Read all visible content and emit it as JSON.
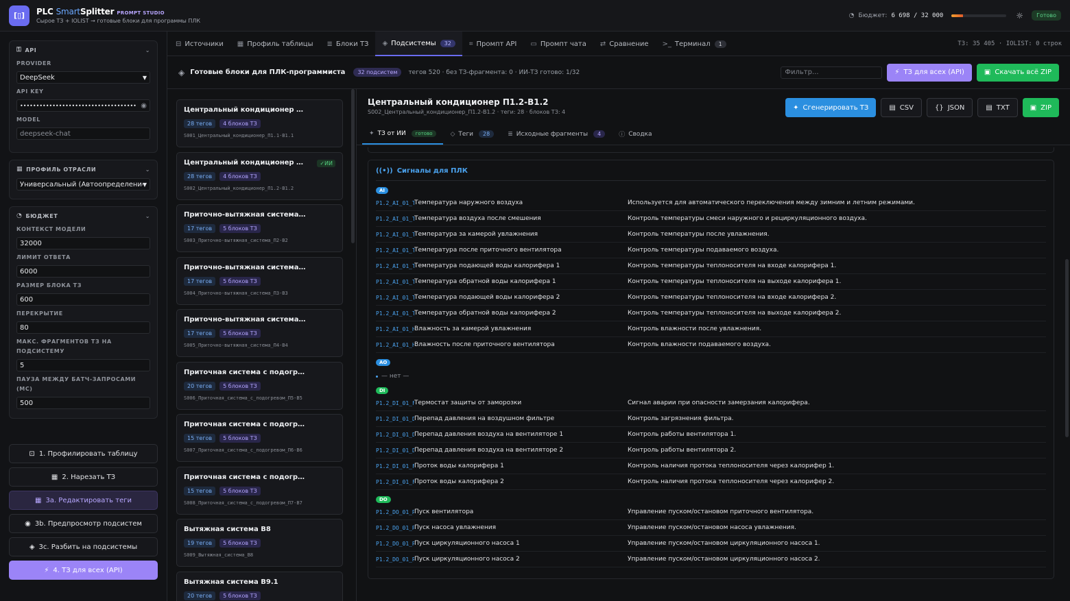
{
  "header": {
    "logo_glyph": "[▯]",
    "brand_plc": "PLC",
    "brand_smart": "Smart",
    "brand_splitter": "Splitter",
    "brand_suffix": "PROMPT STUDIO",
    "subtitle": "Сырое ТЗ + IOLIST → готовые блоки для программы ПЛК",
    "budget_label": "Бюджет:",
    "budget_value": "6 698 / 32 000",
    "budget_used": 6698,
    "budget_total": 32000,
    "status": "Готово"
  },
  "sidebar": {
    "api": {
      "title": "API",
      "provider_label": "PROVIDER",
      "provider_value": "DeepSeek",
      "apikey_label": "API KEY",
      "apikey_value": "••••••••••••••••••••••••••••••••••••",
      "model_label": "MODEL",
      "model_placeholder": "deepseek-chat"
    },
    "profile": {
      "title": "ПРОФИЛЬ ОТРАСЛИ",
      "value": "Универсальный (Автоопределение)"
    },
    "budget": {
      "title": "БЮДЖЕТ",
      "fields": [
        {
          "label": "КОНТЕКСТ МОДЕЛИ",
          "value": "32000"
        },
        {
          "label": "ЛИМИТ ОТВЕТА",
          "value": "6000"
        },
        {
          "label": "РАЗМЕР БЛОКА ТЗ",
          "value": "600"
        },
        {
          "label": "ПЕРЕКРЫТИЕ",
          "value": "80"
        },
        {
          "label": "МАКС. ФРАГМЕНТОВ ТЗ НА ПОДСИСТЕМУ",
          "value": "5"
        },
        {
          "label": "ПАУЗА МЕЖДУ БАТЧ-ЗАПРОСАМИ (МС)",
          "value": "500"
        }
      ]
    },
    "actions": [
      {
        "label": "1. Профилировать таблицу",
        "icon": "scan-icon"
      },
      {
        "label": "2. Нарезать ТЗ",
        "icon": "table-icon"
      },
      {
        "label": "3a. Редактировать теги",
        "icon": "table-icon"
      },
      {
        "label": "3b. Предпросмотр подсистем",
        "icon": "eye-icon"
      },
      {
        "label": "3c. Разбить на подсистемы",
        "icon": "layers-icon"
      },
      {
        "label": "4. ТЗ для всех (API)",
        "icon": "bolt-icon"
      }
    ]
  },
  "tabs": [
    {
      "label": "Источники",
      "icon": "folder-icon",
      "badge": ""
    },
    {
      "label": "Профиль таблицы",
      "icon": "table-icon",
      "badge": ""
    },
    {
      "label": "Блоки ТЗ",
      "icon": "doc-icon",
      "badge": ""
    },
    {
      "label": "Подсистемы",
      "icon": "layers-icon",
      "badge": "32"
    },
    {
      "label": "Промпт API",
      "icon": "code-icon",
      "badge": ""
    },
    {
      "label": "Промпт чата",
      "icon": "chat-icon",
      "badge": ""
    },
    {
      "label": "Сравнение",
      "icon": "compare-icon",
      "badge": ""
    },
    {
      "label": "Терминал",
      "icon": "terminal-icon",
      "badge": "1"
    }
  ],
  "tab_info": "ТЗ: 35 405 · IOLIST: 0 строк",
  "subheader": {
    "title": "Готовые блоки для ПЛК-программиста",
    "count_badge": "32 подсистем",
    "stats": "тегов 520 · без ТЗ-фрагмента: 0 · ИИ-ТЗ готово: 1/32",
    "filter_placeholder": "Фильтр...",
    "btn_all": "ТЗ для всех (API)",
    "btn_zip": "Скачать всё ZIP"
  },
  "subsystems": [
    {
      "title": "Центральный кондиционер П1.1-В1.1",
      "tags": "28 тегов",
      "blocks": "4 блоков ТЗ",
      "id": "S001_Центральный_кондиционер_П1.1-В1.1",
      "ai": ""
    },
    {
      "title": "Центральный кондиционер П1.2-В1.2",
      "tags": "28 тегов",
      "blocks": "4 блоков ТЗ",
      "id": "S002_Центральный_кондиционер_П1.2-В1.2",
      "ai": "✓ИИ"
    },
    {
      "title": "Приточно-вытяжная система П2-В2",
      "tags": "17 тегов",
      "blocks": "5 блоков ТЗ",
      "id": "S003_Приточно-вытяжная_система_П2-В2",
      "ai": ""
    },
    {
      "title": "Приточно-вытяжная система П3-В3",
      "tags": "17 тегов",
      "blocks": "5 блоков ТЗ",
      "id": "S004_Приточно-вытяжная_система_П3-В3",
      "ai": ""
    },
    {
      "title": "Приточно-вытяжная система П4-В4",
      "tags": "17 тегов",
      "blocks": "5 блоков ТЗ",
      "id": "S005_Приточно-вытяжная_система_П4-В4",
      "ai": ""
    },
    {
      "title": "Приточная система с подогревом П5-В5",
      "tags": "20 тегов",
      "blocks": "5 блоков ТЗ",
      "id": "S006_Приточная_система_с_подогревом_П5-В5",
      "ai": ""
    },
    {
      "title": "Приточная система с подогревом П6-В6",
      "tags": "15 тегов",
      "blocks": "5 блоков ТЗ",
      "id": "S007_Приточная_система_с_подогревом_П6-В6",
      "ai": ""
    },
    {
      "title": "Приточная система с подогревом П7-В7",
      "tags": "15 тегов",
      "blocks": "5 блоков ТЗ",
      "id": "S008_Приточная_система_с_подогревом_П7-В7",
      "ai": ""
    },
    {
      "title": "Вытяжная система В8",
      "tags": "19 тегов",
      "blocks": "5 блоков ТЗ",
      "id": "S009_Вытяжная_система_В8",
      "ai": ""
    },
    {
      "title": "Вытяжная система В9.1",
      "tags": "20 тегов",
      "blocks": "5 блоков ТЗ",
      "id": "S010_Вытяжная_система_В9.1",
      "ai": ""
    }
  ],
  "detail": {
    "title": "Центральный кондиционер П1.2-В1.2",
    "subtitle": "S002_Центральный_кондиционер_П1.2-В1.2 · теги: 28 · блоков ТЗ: 4",
    "btn_generate": "Сгенерировать ТЗ",
    "btn_csv": "CSV",
    "btn_json": "JSON",
    "btn_txt": "TXT",
    "btn_zip": "ZIP",
    "tabs": [
      {
        "label": "ТЗ от ИИ",
        "badge": "готово",
        "icon": "sparkle-icon"
      },
      {
        "label": "Теги",
        "badge": "28",
        "icon": "tag-icon"
      },
      {
        "label": "Исходные фрагменты",
        "badge": "4",
        "icon": "doc-icon"
      },
      {
        "label": "Сводка",
        "badge": "",
        "icon": "info-icon"
      }
    ],
    "signals_title": "Сигналы для ПЛК",
    "groups": [
      {
        "name": "AI",
        "rows": [
          {
            "id": "P1.2_AI_01_Temp",
            "name": "Температура наружного воздуха",
            "desc": "Используется для автоматического переключения между зимним и летним режимами."
          },
          {
            "id": "P1.2_AI_01_Temp",
            "name": "Температура воздуха после смешения",
            "desc": "Контроль температуры смеси наружного и рециркуляционного воздуха."
          },
          {
            "id": "P1.2_AI_01_Temp",
            "name": "Температура за камерой увлажнения",
            "desc": "Контроль температуры после увлажнения."
          },
          {
            "id": "P1.2_AI_01_Temp",
            "name": "Температура после приточного вентилятора",
            "desc": "Контроль температуры подаваемого воздуха."
          },
          {
            "id": "P1.2_AI_01_Temp",
            "name": "Температура подающей воды калорифера 1",
            "desc": "Контроль температуры теплоносителя на входе калорифера 1."
          },
          {
            "id": "P1.2_AI_01_Temp",
            "name": "Температура обратной воды калорифера 1",
            "desc": "Контроль температуры теплоносителя на выходе калорифера 1."
          },
          {
            "id": "P1.2_AI_01_Temp",
            "name": "Температура подающей воды калорифера 2",
            "desc": "Контроль температуры теплоносителя на входе калорифера 2."
          },
          {
            "id": "P1.2_AI_01_Temp",
            "name": "Температура обратной воды калорифера 2",
            "desc": "Контроль температуры теплоносителя на выходе калорифера 2."
          },
          {
            "id": "P1.2_AI_01_Hum",
            "name": "Влажность за камерой увлажнения",
            "desc": "Контроль влажности после увлажнения."
          },
          {
            "id": "P1.2_AI_01_Hum",
            "name": "Влажность после приточного вентилятора",
            "desc": "Контроль влажности подаваемого воздуха."
          }
        ]
      },
      {
        "name": "AO",
        "rows": [],
        "none": "— нет —"
      },
      {
        "name": "DI",
        "rows": [
          {
            "id": "P1.2_DI_01_Frz",
            "name": "Термостат защиты от заморозки",
            "desc": "Сигнал аварии при опасности замерзания калорифера."
          },
          {
            "id": "P1.2_DI_01_DPF",
            "name": "Перепад давления на воздушном фильтре",
            "desc": "Контроль загрязнения фильтра."
          },
          {
            "id": "P1.2_DI_01_DPV",
            "name": "Перепад давления воздуха на вентиляторе 1",
            "desc": "Контроль работы вентилятора 1."
          },
          {
            "id": "P1.2_DI_01_DPV",
            "name": "Перепад давления воздуха на вентиляторе 2",
            "desc": "Контроль работы вентилятора 2."
          },
          {
            "id": "P1.2_DI_01_Flw",
            "name": "Проток воды калорифера 1",
            "desc": "Контроль наличия протока теплоносителя через калорифер 1."
          },
          {
            "id": "P1.2_DI_01_Flw",
            "name": "Проток воды калорифера 2",
            "desc": "Контроль наличия протока теплоносителя через калорифер 2."
          }
        ]
      },
      {
        "name": "DO",
        "rows": [
          {
            "id": "P1.2_DO_01_Run",
            "name": "Пуск вентилятора",
            "desc": "Управление пуском/остановом приточного вентилятора."
          },
          {
            "id": "P1.2_DO_01_Run",
            "name": "Пуск насоса увлажнения",
            "desc": "Управление пуском/остановом насоса увлажнения."
          },
          {
            "id": "P1.2_DO_01_Run",
            "name": "Пуск циркуляционного насоса 1",
            "desc": "Управление пуском/остановом циркуляционного насоса 1."
          },
          {
            "id": "P1.2_DO_01_Run",
            "name": "Пуск циркуляционного насоса 2",
            "desc": "Управление пуском/остановом циркуляционного насоса 2."
          }
        ]
      }
    ]
  }
}
